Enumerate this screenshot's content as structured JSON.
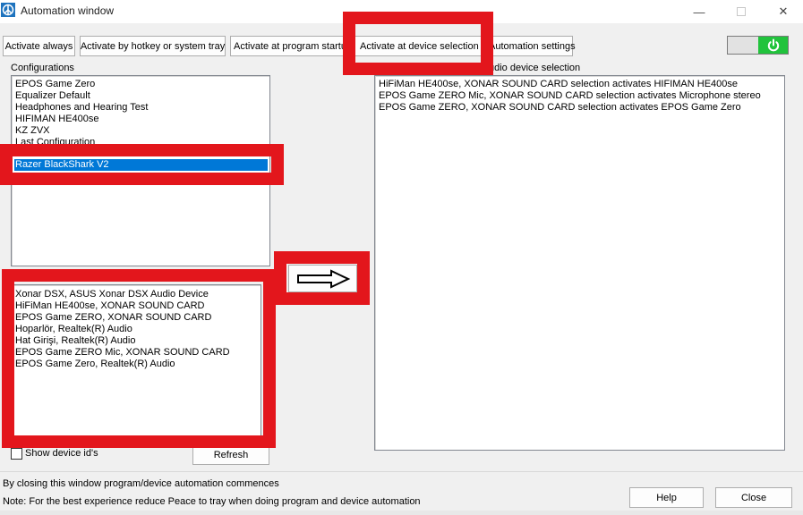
{
  "window": {
    "title": "Automation window"
  },
  "titlebar": {
    "minimize_glyph": "—",
    "close_glyph": "✕"
  },
  "tabs": [
    {
      "label": "Activate always"
    },
    {
      "label": "Activate by hotkey or system tray"
    },
    {
      "label": "Activate at program startup"
    },
    {
      "label": "Activate at device selection"
    },
    {
      "label": "Automation settings"
    }
  ],
  "toggle": {
    "state": "on",
    "color": "#21c33c"
  },
  "configurations": {
    "label": "Configurations",
    "items": [
      "EPOS Game Zero",
      "Equalizer Default",
      "Headphones and Hearing Test",
      "HIFIMAN HE400se",
      "KZ ZVX",
      "Last Configuration",
      "Razer BlackShark V2"
    ],
    "selected": "Razer BlackShark V2"
  },
  "audio_selection": {
    "label": "udio device selection",
    "items": [
      "HiFiMan HE400se, XONAR SOUND CARD selection activates HIFIMAN HE400se",
      "EPOS Game ZERO Mic, XONAR SOUND CARD selection activates Microphone stereo",
      "EPOS Game ZERO, XONAR SOUND CARD selection activates EPOS Game Zero"
    ]
  },
  "devices": {
    "items": [
      "Xonar DSX, ASUS Xonar DSX Audio Device",
      "HiFiMan HE400se, XONAR SOUND CARD",
      "EPOS Game ZERO, XONAR SOUND CARD",
      "Hoparlör, Realtek(R) Audio",
      "Hat Girişi, Realtek(R) Audio",
      "EPOS Game ZERO Mic, XONAR SOUND CARD",
      "EPOS Game Zero, Realtek(R) Audio"
    ]
  },
  "show_device_ids": {
    "label": "Show device id's",
    "checked": false
  },
  "refresh_button": {
    "label": "Refresh"
  },
  "footer": {
    "line1": "By closing this window program/device automation commences",
    "line2": "Note: For the best experience reduce Peace to tray when doing program and device automation"
  },
  "help_button": {
    "label": "Help"
  },
  "close_button": {
    "label": "Close"
  },
  "highlight_color": "#e3161c",
  "selection_color": "#0078d7"
}
